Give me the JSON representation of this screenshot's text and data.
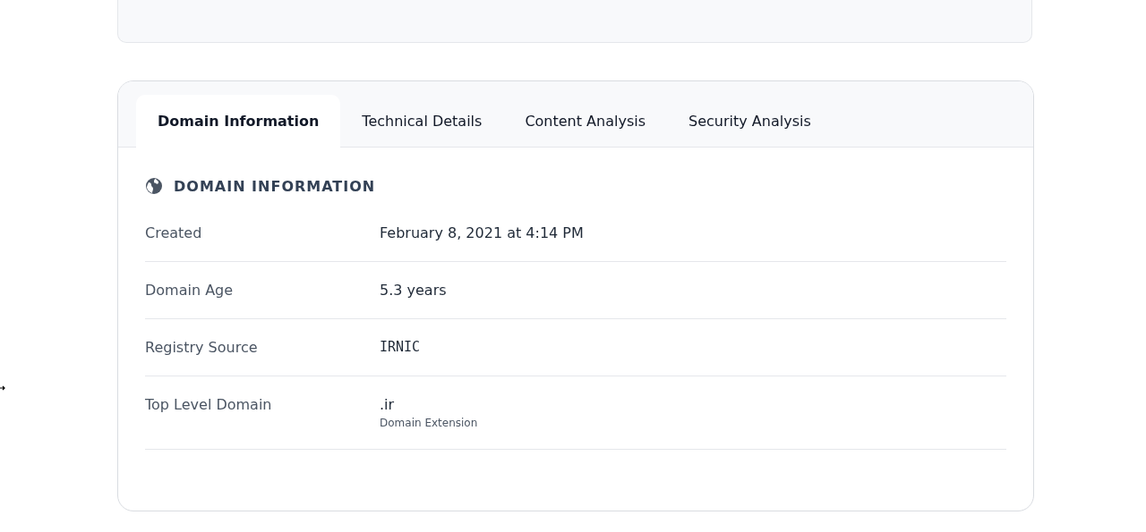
{
  "tabs": [
    {
      "label": "Domain Information",
      "selected": true
    },
    {
      "label": "Technical Details",
      "selected": false
    },
    {
      "label": "Content Analysis",
      "selected": false
    },
    {
      "label": "Security Analysis",
      "selected": false
    }
  ],
  "section": {
    "title": "DOMAIN INFORMATION"
  },
  "rows": [
    {
      "label": "Created",
      "value": "February 8, 2021 at 4:14 PM",
      "kind": "text"
    },
    {
      "label": "Domain Age",
      "value": "5.3 years",
      "kind": "text"
    },
    {
      "label": "Registry Source",
      "value": "IRNIC",
      "kind": "mono"
    },
    {
      "label": "Top Level Domain",
      "value": ".ir",
      "note": "Domain Extension",
      "kind": "text"
    }
  ]
}
